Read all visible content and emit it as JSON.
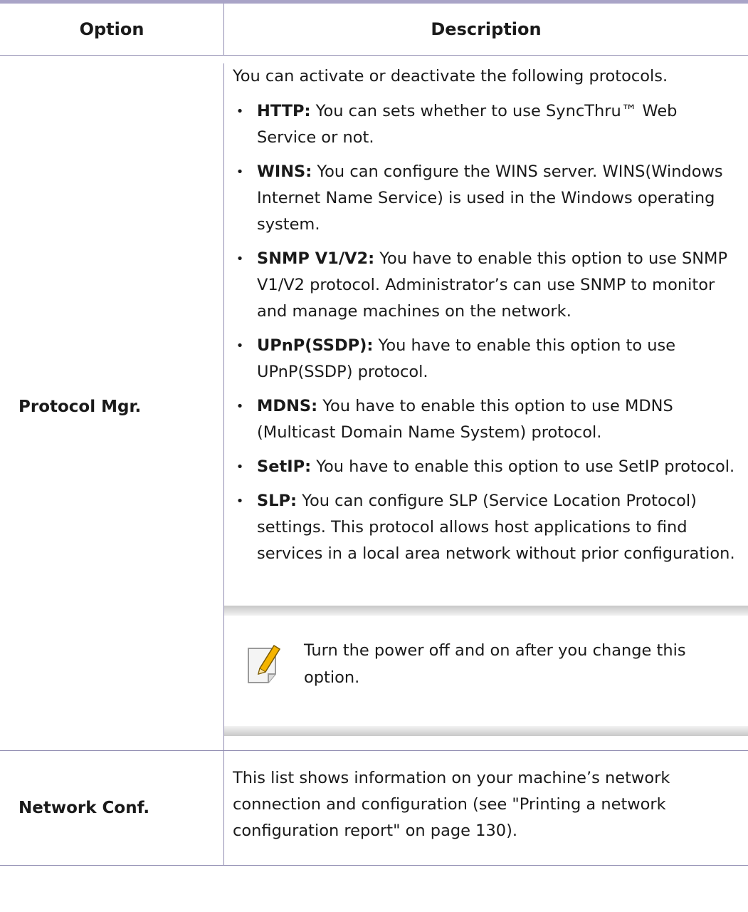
{
  "table": {
    "headers": {
      "option": "Option",
      "description": "Description"
    },
    "protocol": {
      "option": "Protocol Mgr.",
      "intro": "You can activate or deactivate the following protocols.",
      "items": [
        {
          "term": "HTTP:",
          "text": " You can sets whether to use SyncThru™ Web Service or not."
        },
        {
          "term": "WINS:",
          "text": " You can configure the WINS server. WINS(Windows Internet Name Service) is used in the Windows operating system."
        },
        {
          "term": "SNMP V1/V2:",
          "text": " You have to enable this option to use SNMP V1/V2 protocol. Administrator’s can use SNMP to monitor and manage machines on the network."
        },
        {
          "term": "UPnP(SSDP):",
          "text": " You have to enable this option to use UPnP(SSDP) protocol."
        },
        {
          "term": "MDNS:",
          "text": " You have to enable this option to use MDNS (Multicast Domain Name System) protocol."
        },
        {
          "term": "SetIP:",
          "text": " You have to enable this option to use SetIP protocol."
        },
        {
          "term": "SLP:",
          "text": " You can configure SLP (Service Location Protocol) settings. This protocol allows host applications to find services in a local area network without prior configuration."
        }
      ],
      "note": "Turn the power off and on after you change this option."
    },
    "network": {
      "option": "Network Conf.",
      "description": "This list shows information on your machine’s network connection and configuration (see \"Printing a network configuration report\" on page 130)."
    }
  },
  "colors": {
    "rule": "#a9a4c7",
    "border": "#8f8bb0",
    "pencil": "#f5b400"
  },
  "icons": {
    "note": "pencil-note-icon"
  }
}
